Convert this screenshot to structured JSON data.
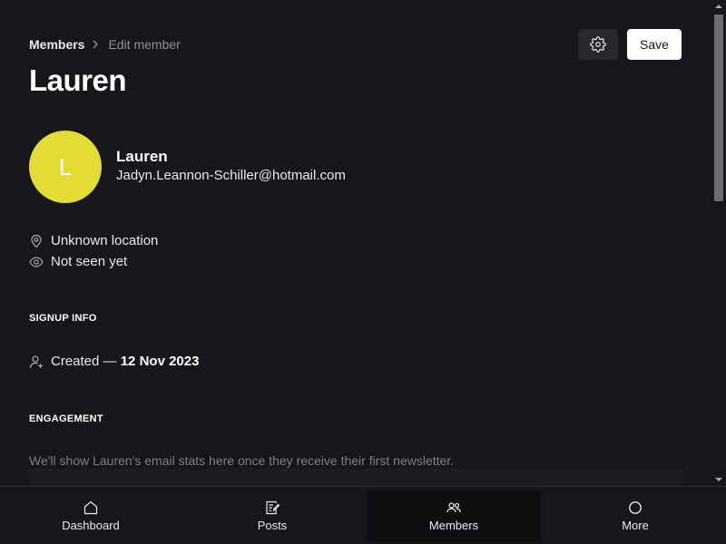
{
  "breadcrumb": {
    "parent": "Members",
    "current": "Edit member"
  },
  "header": {
    "title": "Lauren",
    "save_label": "Save",
    "settings_icon": "gear-icon"
  },
  "member": {
    "avatar_initial": "L",
    "avatar_color": "#e2dc35",
    "name": "Lauren",
    "email": "Jadyn.Leannon-Schiller@hotmail.com",
    "location": "Unknown location",
    "last_seen": "Not seen yet"
  },
  "signup": {
    "section_title": "SIGNUP INFO",
    "created_label": "Created —",
    "created_date": "12 Nov 2023"
  },
  "engagement": {
    "section_title": "ENGAGEMENT",
    "empty_text": "We'll show Lauren's email stats here once they receive their first newsletter."
  },
  "bottom_nav": [
    {
      "label": "Dashboard",
      "icon": "home-icon",
      "active": false
    },
    {
      "label": "Posts",
      "icon": "posts-icon",
      "active": false
    },
    {
      "label": "Members",
      "icon": "members-icon",
      "active": true
    },
    {
      "label": "More",
      "icon": "more-circle-icon",
      "active": false
    }
  ]
}
